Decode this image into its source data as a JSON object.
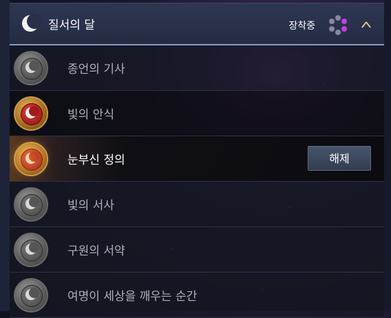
{
  "header": {
    "icon": "crescent-moon-icon",
    "title": "질서의 달",
    "status_label": "장착중",
    "status_icon": "rune-dots-icon",
    "collapse_icon": "chevron-up-icon"
  },
  "items": [
    {
      "label": "종언의 기사",
      "emblem": "silver",
      "selected": false
    },
    {
      "label": "빛의 안식",
      "emblem": "red",
      "selected": false
    },
    {
      "label": "눈부신 정의",
      "emblem": "red",
      "selected": true,
      "action_label": "해제"
    },
    {
      "label": "빛의 서사",
      "emblem": "silver",
      "selected": false
    },
    {
      "label": "구원의 서약",
      "emblem": "silver",
      "selected": false
    },
    {
      "label": "여명이 세상을 깨우는 순간",
      "emblem": "silver",
      "selected": false
    }
  ],
  "colors": {
    "header_bg": "#29304a",
    "header_border": "#7fa0c6",
    "accent_purple": "#c23fe0",
    "chevron": "#e4c98a"
  }
}
